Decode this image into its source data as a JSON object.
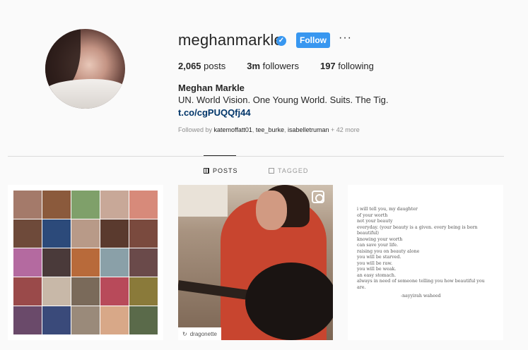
{
  "profile": {
    "username": "meghanmarkle",
    "follow_label": "Follow",
    "more_label": "···",
    "posts_count": "2,065",
    "posts_label": "posts",
    "followers_count": "3m",
    "followers_label": "followers",
    "following_count": "197",
    "following_label": "following",
    "full_name": "Meghan Markle",
    "bio": "UN. World Vision. One Young World. Suits. The Tig.",
    "link": "t.co/cgPUQQfj44",
    "followed_prefix": "Followed by ",
    "followed_user1": "katemoffatt01",
    "followed_user2": "tee_burke",
    "followed_user3": "isabelletruman",
    "followed_more": "+ 42 more"
  },
  "tabs": {
    "posts": "POSTS",
    "tagged": "TAGGED"
  },
  "posts": {
    "repost_user": "dragonette",
    "poem": {
      "lines": [
        "i will tell you, my daughter",
        "of your worth",
        "not your beauty",
        "everyday. (your beauty is a given. every being is born",
        "beautiful)",
        "knowing your worth",
        "can save your life.",
        "raising you on beauty alone",
        "you will be starved.",
        "you will be raw.",
        "you will be weak.",
        "an easy stomach.",
        "always in need of someone telling you how beautiful you",
        "are."
      ],
      "signature": "-nayyirah waheed"
    }
  },
  "colors": {
    "accent": "#3897f0",
    "link": "#003569"
  }
}
